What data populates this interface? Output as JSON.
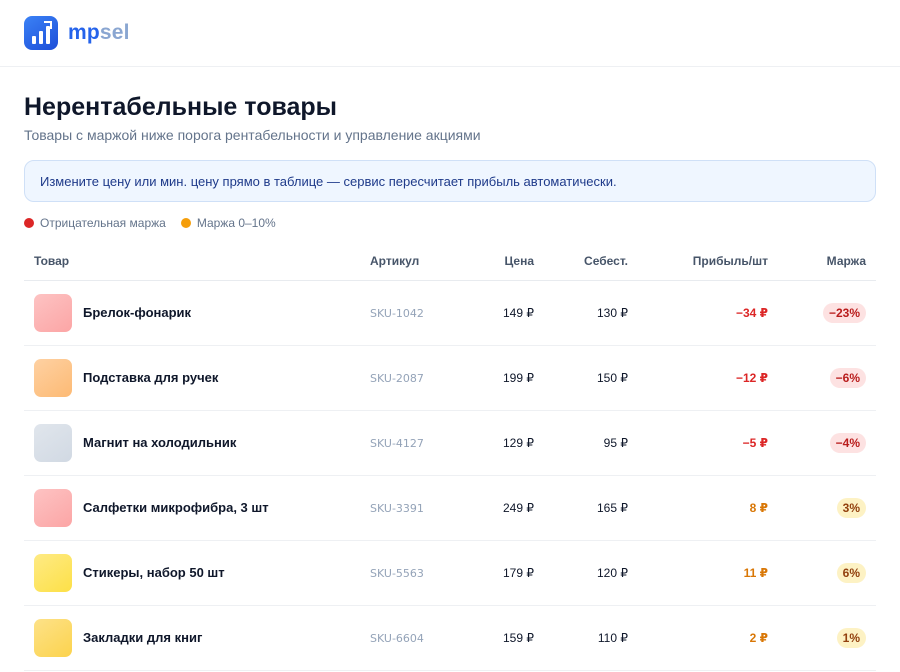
{
  "brand": {
    "part1": "mp",
    "part2": "sel"
  },
  "page": {
    "title": "Нерентабельные товары",
    "subtitle": "Товары с маржой ниже порога рентабельности и управление акциями"
  },
  "notice": "Измените цену или мин. цену прямо в таблице — сервис пересчитает прибыль автоматически.",
  "legend": [
    {
      "label": "Отрицательная маржа",
      "color": "#dc2626"
    },
    {
      "label": "Маржа 0–10%",
      "color": "#f59e0b"
    }
  ],
  "table": {
    "headers": [
      "Товар",
      "Артикул",
      "Цена",
      "Себест.",
      "Прибыль/шт",
      "Маржа"
    ],
    "rows": [
      {
        "name": "Брелок-фонарик",
        "sku": "SKU-1042",
        "price": "149 ₽",
        "cost": "130 ₽",
        "profit": "−34 ₽",
        "margin": "−23%",
        "status": "neg",
        "thumb": "#fca5a5"
      },
      {
        "name": "Подставка для ручек",
        "sku": "SKU-2087",
        "price": "199 ₽",
        "cost": "150 ₽",
        "profit": "−12 ₽",
        "margin": "−6%",
        "status": "neg",
        "thumb": "#fdba74"
      },
      {
        "name": "Магнит на холодильник",
        "sku": "SKU-4127",
        "price": "129 ₽",
        "cost": "95 ₽",
        "profit": "−5 ₽",
        "margin": "−4%",
        "status": "neg",
        "thumb": "#d1d9e3"
      },
      {
        "name": "Салфетки микрофибра, 3 шт",
        "sku": "SKU-3391",
        "price": "249 ₽",
        "cost": "165 ₽",
        "profit": "8 ₽",
        "margin": "3%",
        "status": "low",
        "thumb": "#fca5a5"
      },
      {
        "name": "Стикеры, набор 50 шт",
        "sku": "SKU-5563",
        "price": "179 ₽",
        "cost": "120 ₽",
        "profit": "11 ₽",
        "margin": "6%",
        "status": "low",
        "thumb": "#fde047"
      },
      {
        "name": "Закладки для книг",
        "sku": "SKU-6604",
        "price": "159 ₽",
        "cost": "110 ₽",
        "profit": "2 ₽",
        "margin": "1%",
        "status": "low",
        "thumb": "#fcd34d"
      }
    ]
  }
}
